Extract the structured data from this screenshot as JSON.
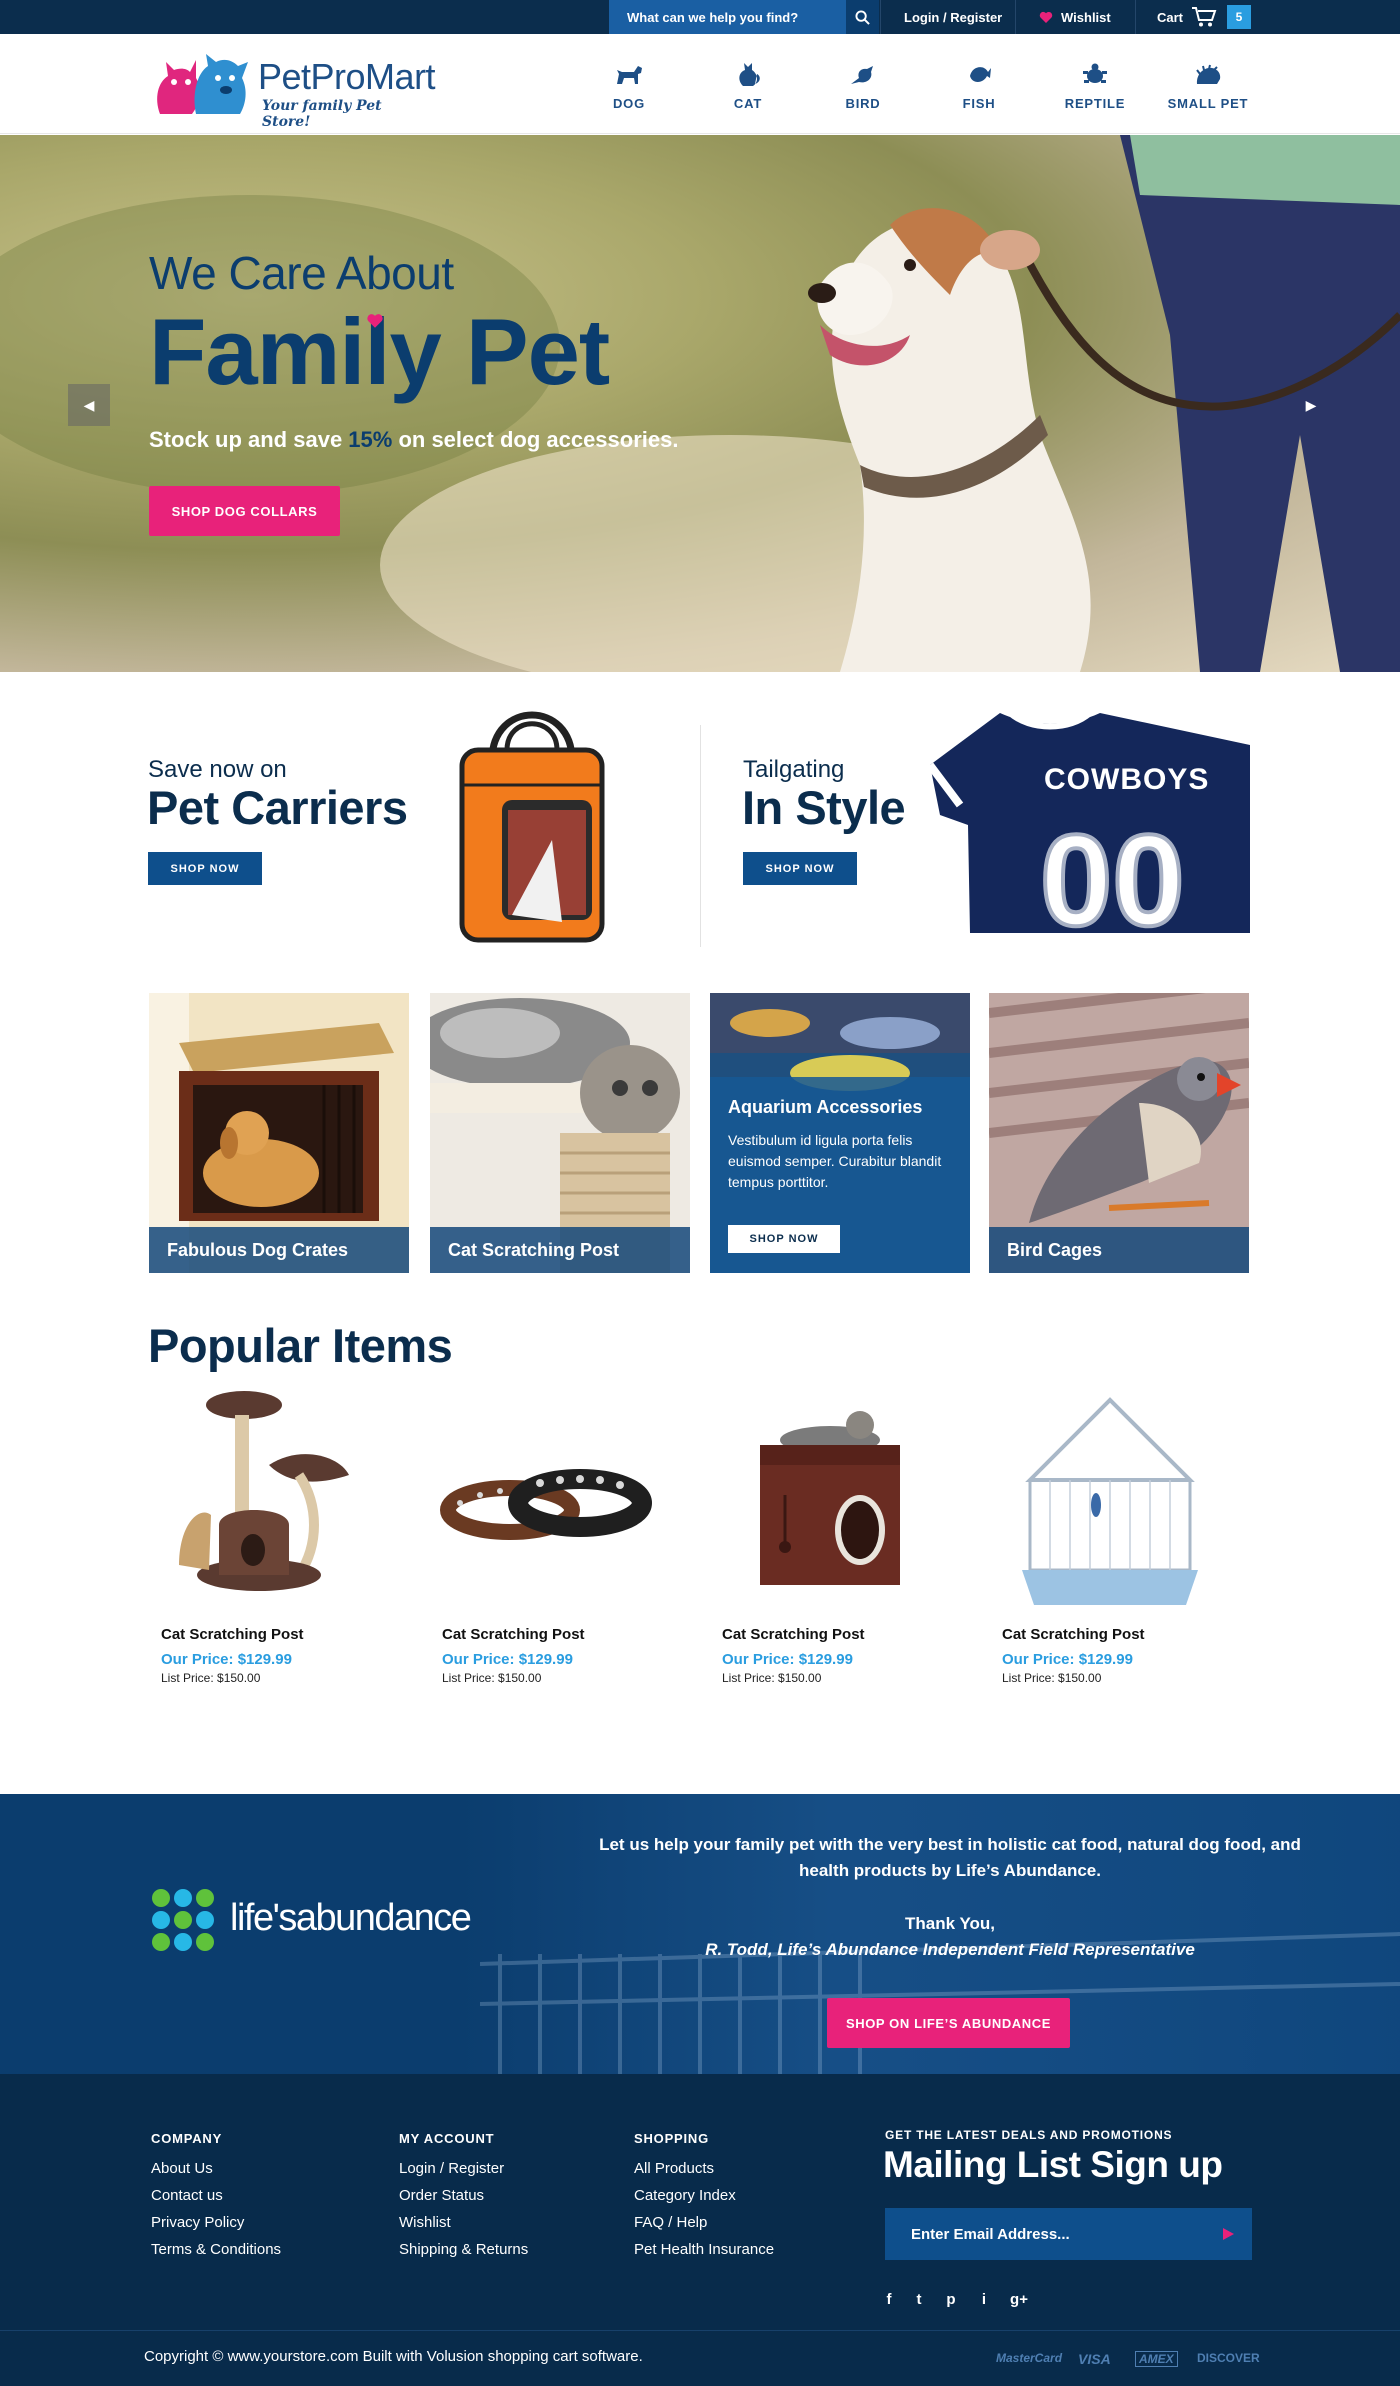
{
  "topbar": {
    "search_placeholder": "What can we help you find?",
    "login": "Login / Register",
    "wishlist": "Wishlist",
    "cart": "Cart",
    "cart_count": "5"
  },
  "header": {
    "logo_name": "PetProMart",
    "logo_tagline": "Your family Pet Store!",
    "nav": [
      {
        "label": "DOG",
        "icon": "dog-icon"
      },
      {
        "label": "CAT",
        "icon": "cat-icon"
      },
      {
        "label": "BIRD",
        "icon": "bird-icon"
      },
      {
        "label": "FISH",
        "icon": "fish-icon"
      },
      {
        "label": "REPTILE",
        "icon": "reptile-icon"
      },
      {
        "label": "SMALL PET",
        "icon": "small-pet-icon"
      }
    ]
  },
  "hero": {
    "subtitle": "We Care About",
    "title": "Family Pet",
    "text_before": "Stock up and save ",
    "text_pct": "15%",
    "text_after": " on select dog accessories.",
    "button": "SHOP DOG COLLARS",
    "prev": "◀",
    "next": "▶"
  },
  "promos": [
    {
      "subtitle": "Save now on",
      "title": "Pet Carriers",
      "button": "SHOP NOW"
    },
    {
      "subtitle": "Tailgating",
      "title": "In Style",
      "button": "SHOP NOW",
      "jersey_text": "COWBOYS",
      "jersey_number": "00"
    }
  ],
  "tiles": [
    {
      "caption": "Fabulous Dog Crates"
    },
    {
      "caption": "Cat Scratching Post"
    },
    {
      "title": "Aquarium Accessories",
      "text": "Vestibulum id ligula porta felis euismod semper. Curabitur blandit tempus porttitor.",
      "button": "SHOP NOW"
    },
    {
      "caption": "Bird Cages"
    }
  ],
  "popular": {
    "title": "Popular Items",
    "items": [
      {
        "name": "Cat Scratching Post",
        "price": "Our Price: $129.99",
        "list": "List Price: $150.00"
      },
      {
        "name": "Cat Scratching Post",
        "price": "Our Price: $129.99",
        "list": "List Price: $150.00"
      },
      {
        "name": "Cat Scratching Post",
        "price": "Our Price: $129.99",
        "list": "List Price: $150.00"
      },
      {
        "name": "Cat Scratching Post",
        "price": "Our Price: $129.99",
        "list": "List Price: $150.00"
      }
    ]
  },
  "lifes_abundance": {
    "logo_text": "life'sabundance",
    "message": "Let us help your family pet with the very best in holistic cat food, natural dog food, and health products by Life’s Abundance.",
    "thanks": "Thank You,",
    "rep": "R. Todd, Life’s Abundance Independent Field Representative",
    "button": "SHOP ON LIFE’S ABUNDANCE"
  },
  "footer": {
    "columns": [
      {
        "title": "COMPANY",
        "links": [
          "About Us",
          "Contact us",
          "Privacy Policy",
          "Terms & Conditions"
        ]
      },
      {
        "title": "MY ACCOUNT",
        "links": [
          "Login / Register",
          "Order Status",
          "Wishlist",
          "Shipping & Returns"
        ]
      },
      {
        "title": "SHOPPING",
        "links": [
          "All Products",
          "Category Index",
          "FAQ / Help",
          "Pet Health Insurance"
        ]
      }
    ],
    "mailing_kicker": "GET THE LATEST DEALS AND PROMOTIONS",
    "mailing_title": "Mailing List Sign up",
    "email_placeholder": "Enter Email Address...",
    "social": [
      "f",
      "t",
      "p",
      "i",
      "g+"
    ],
    "copyright": "Copyright © www.yourstore.com Built with Volusion shopping cart software.",
    "payments": [
      "MasterCard",
      "VISA",
      "AMEX",
      "DISCOVER"
    ]
  },
  "colors": {
    "navy": "#0b2d4d",
    "blue": "#1a5fa3",
    "pink": "#e8227a",
    "accent": "#2a9de0"
  }
}
